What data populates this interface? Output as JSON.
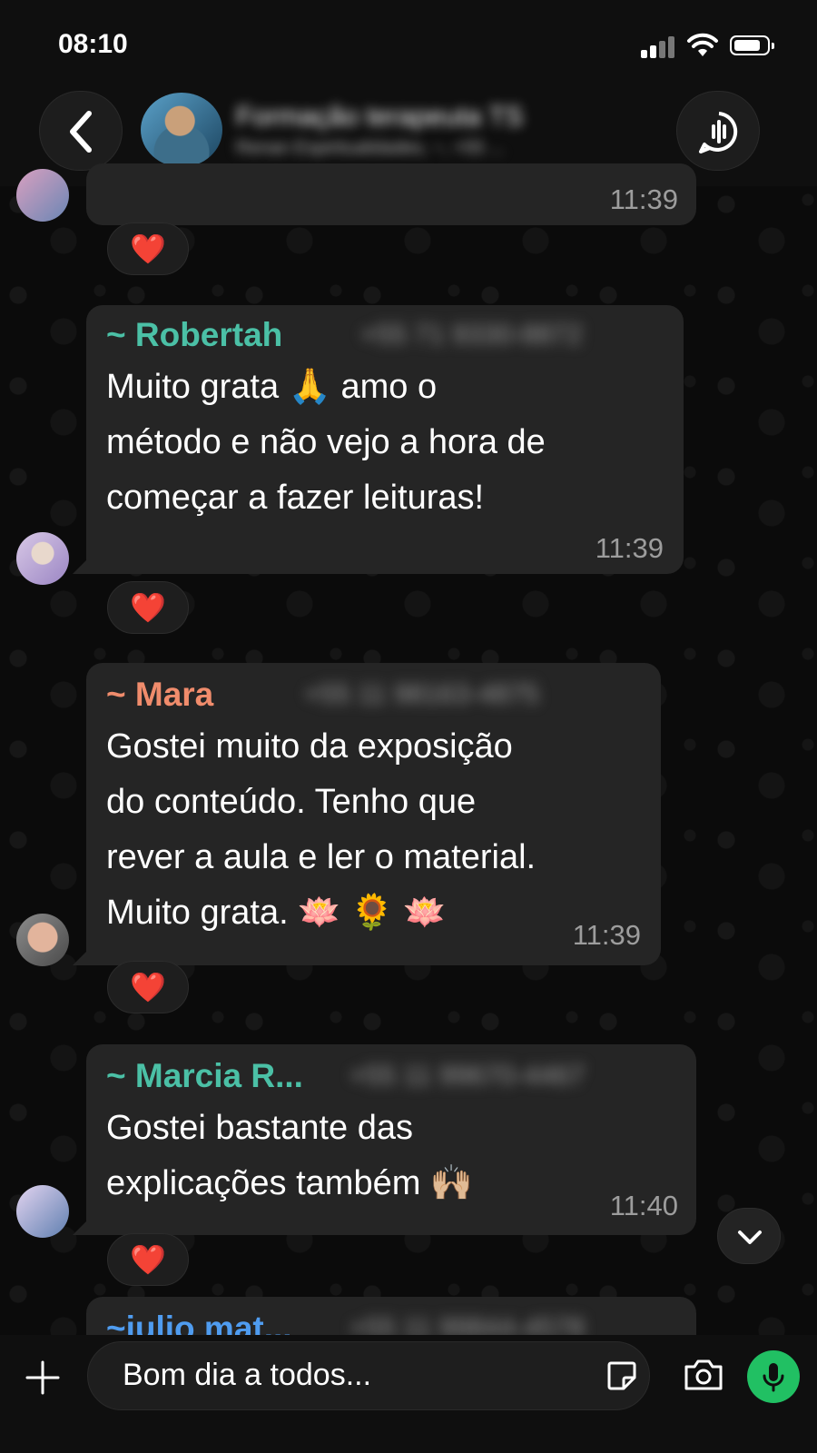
{
  "status_bar": {
    "time": "08:10"
  },
  "header": {
    "group_name": "Formação terapeuta TS",
    "group_subtitle": "Renan Espiritualidades, ~, +55 ..."
  },
  "messages": [
    {
      "sender": "",
      "time": "11:39",
      "reaction": "❤️"
    },
    {
      "sender": "~ Robertah",
      "sender_color": "#4bc0a6",
      "phone": "+55 71 9330-8872",
      "text": "Muito grata 🙏 amo o\nmétodo e não vejo a hora de\ncomeçar a fazer leituras!",
      "time": "11:39",
      "reaction": "❤️"
    },
    {
      "sender": "~ Mara",
      "sender_color": "#f08c6c",
      "phone": "+55 11 98163-4875",
      "text": "Gostei muito da exposição\ndo conteúdo. Tenho que\nrever a aula e ler o material.\nMuito grata. 🪷 🌻 🪷",
      "time": "11:39",
      "reaction": "❤️"
    },
    {
      "sender": "~ Marcia R...",
      "sender_color": "#4bc0a6",
      "phone": "+55 11 99670-4467",
      "text": "Gostei bastante das\nexplicações também 🙌🏼",
      "time": "11:40",
      "reaction": "❤️"
    },
    {
      "sender": "~julio mat...",
      "sender_color": "#4f9cf0",
      "phone": "+55 11 99844-4578"
    }
  ],
  "input": {
    "value": "Bom dia a todos..."
  },
  "icons": {
    "back": "chevron-left-icon",
    "voice_chat": "voice-chat-icon",
    "scroll_down": "chevron-down-icon",
    "attach": "plus-icon",
    "sticker": "sticker-icon",
    "camera": "camera-icon",
    "mic": "microphone-icon"
  },
  "colors": {
    "mic_button": "#21c063",
    "bubble": "#252525",
    "reaction_heart": "#ff2d3d"
  }
}
